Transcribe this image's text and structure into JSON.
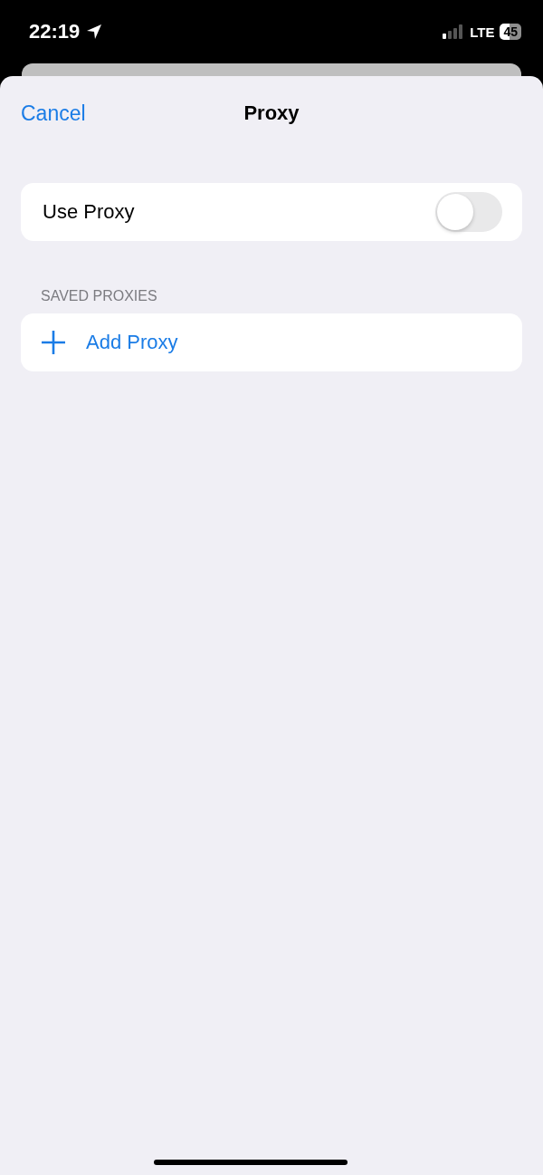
{
  "status_bar": {
    "time": "22:19",
    "network": "LTE",
    "battery": "45"
  },
  "nav": {
    "cancel": "Cancel",
    "title": "Proxy"
  },
  "use_proxy": {
    "label": "Use Proxy",
    "on": false
  },
  "saved_proxies": {
    "header": "SAVED PROXIES",
    "add": "Add Proxy"
  }
}
